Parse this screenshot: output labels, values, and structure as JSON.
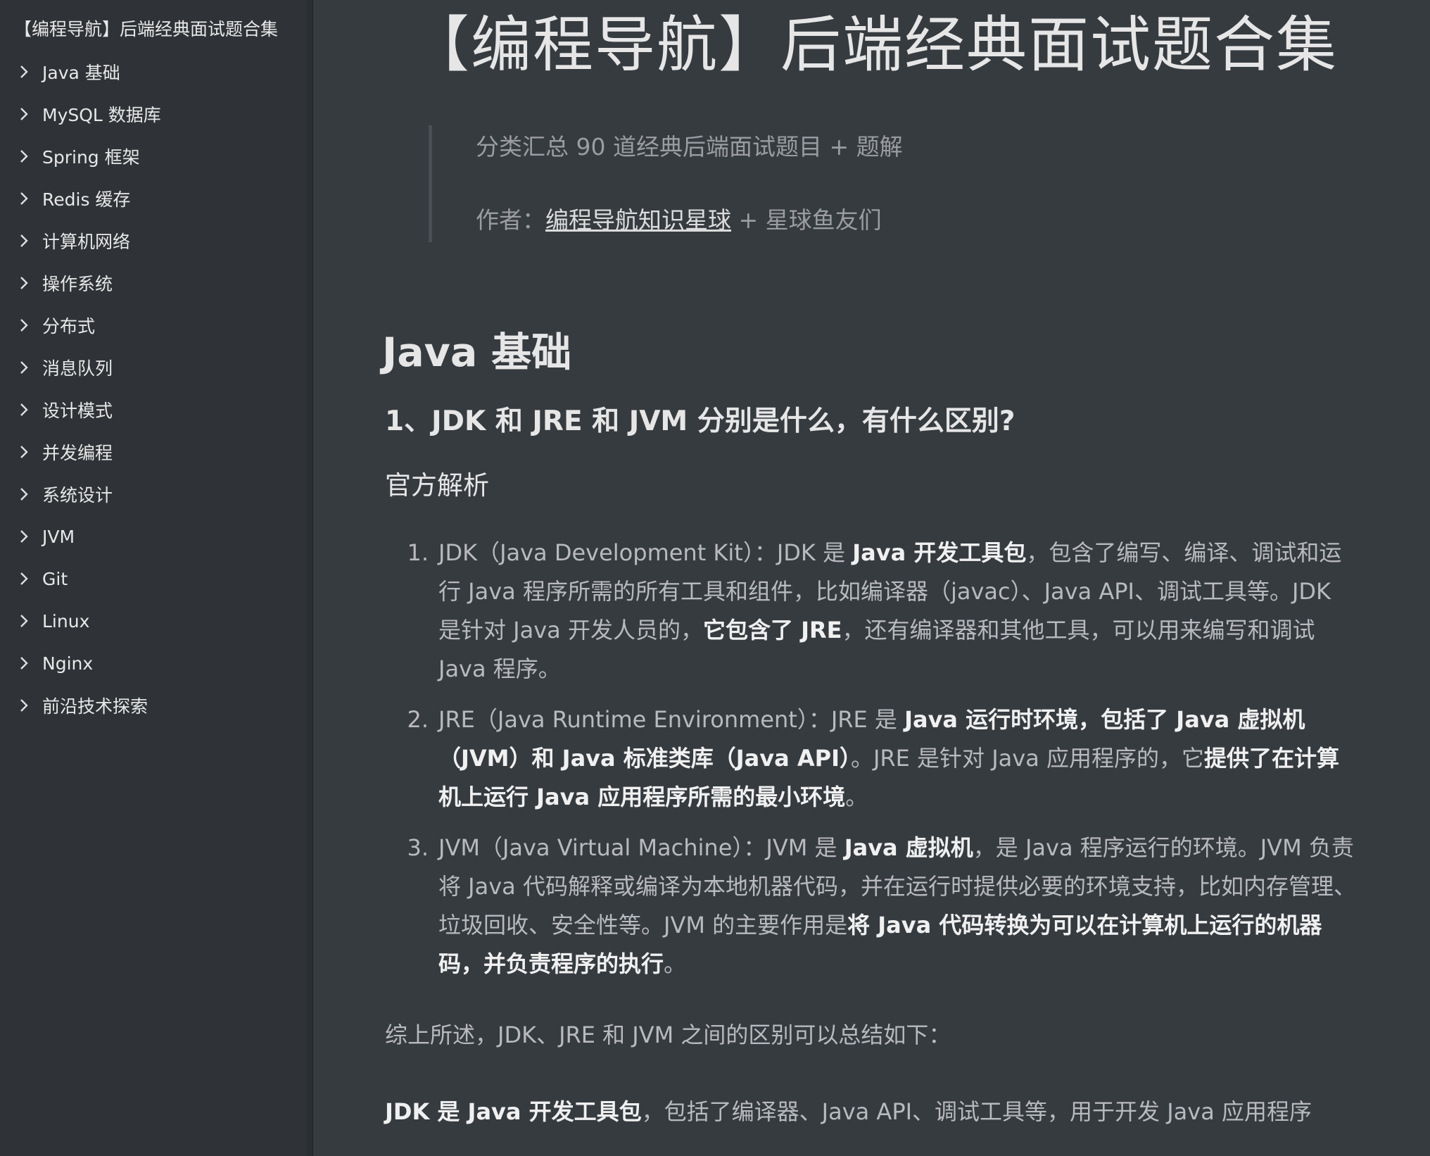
{
  "sidebar": {
    "doc_title": "【编程导航】后端经典面试题合集",
    "items": [
      {
        "label": "Java 基础"
      },
      {
        "label": "MySQL 数据库"
      },
      {
        "label": "Spring 框架"
      },
      {
        "label": "Redis 缓存"
      },
      {
        "label": "计算机网络"
      },
      {
        "label": "操作系统"
      },
      {
        "label": "分布式"
      },
      {
        "label": "消息队列"
      },
      {
        "label": "设计模式"
      },
      {
        "label": "并发编程"
      },
      {
        "label": "系统设计"
      },
      {
        "label": "JVM"
      },
      {
        "label": "Git"
      },
      {
        "label": "Linux"
      },
      {
        "label": "Nginx"
      },
      {
        "label": "前沿技术探索"
      }
    ]
  },
  "main": {
    "title": "【编程导航】后端经典面试题合集",
    "quote": {
      "line1": "分类汇总 90 道经典后端面试题目 + 题解",
      "author_prefix": "作者：",
      "author_link": "编程导航知识星球",
      "author_suffix": " + 星球鱼友们"
    },
    "section_title": "Java 基础",
    "question_title": "1、JDK 和 JRE 和 JVM 分别是什么，有什么区别?",
    "subheading": "官方解析",
    "list": [
      {
        "num": "1.",
        "p1": "JDK（Java Development Kit）：JDK 是 ",
        "b1": "Java 开发工具包",
        "p2": "，包含了编写、编译、调试和运行 Java 程序所需的所有工具和组件，比如编译器（javac）、Java API、调试工具等。JDK 是针对 Java 开发人员的，",
        "b2": "它包含了 JRE",
        "p3": "，还有编译器和其他工具，可以用来编写和调试 Java 程序。"
      },
      {
        "num": "2.",
        "p1": "JRE（Java Runtime Environment）：JRE 是 ",
        "b1": "Java 运行时环境，包括了 Java 虚拟机（JVM）和 Java 标准类库（Java API）",
        "p2": "。JRE 是针对 Java 应用程序的，它",
        "b2": "提供了在计算机上运行 Java 应用程序所需的最小环境",
        "p3": "。"
      },
      {
        "num": "3.",
        "p1": "JVM（Java Virtual Machine）：JVM 是 ",
        "b1": "Java 虚拟机",
        "p2": "，是 Java 程序运行的环境。JVM 负责将 Java 代码解释或编译为本地机器代码，并在运行时提供必要的环境支持，比如内存管理、垃圾回收、安全性等。JVM 的主要作用是",
        "b2": "将 Java 代码转换为可以在计算机上运行的机器码，并负责程序的执行",
        "p3": "。"
      }
    ],
    "summary": "综上所述，JDK、JRE 和 JVM 之间的区别可以总结如下：",
    "next_bold": "JDK 是 Java 开发工具包",
    "next_text": "，包括了编译器、Java API、调试工具等，用于开发 Java 应用程序"
  },
  "colors": {
    "sidebar_bg": "#2f3337",
    "main_bg": "#363b40",
    "text": "#b8babd",
    "heading": "#e6e6e6"
  },
  "icons": {
    "toc_item": "chevron-right-icon"
  }
}
